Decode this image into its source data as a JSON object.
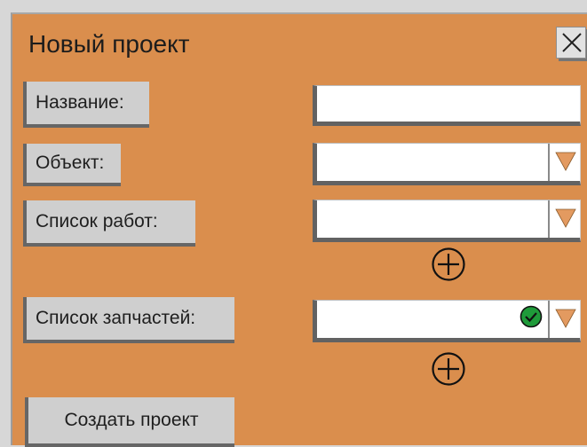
{
  "dialog": {
    "title": "Новый проект",
    "close_icon": "close-icon"
  },
  "fields": {
    "name_label": "Название:",
    "object_label": "Объект:",
    "works_label": "Список работ:",
    "parts_label": "Список запчастей:"
  },
  "buttons": {
    "create_label": "Создать проект"
  },
  "colors": {
    "dialog_bg": "#da8e4d",
    "arrow": "#e39a60",
    "check": "#1f9b3a"
  }
}
